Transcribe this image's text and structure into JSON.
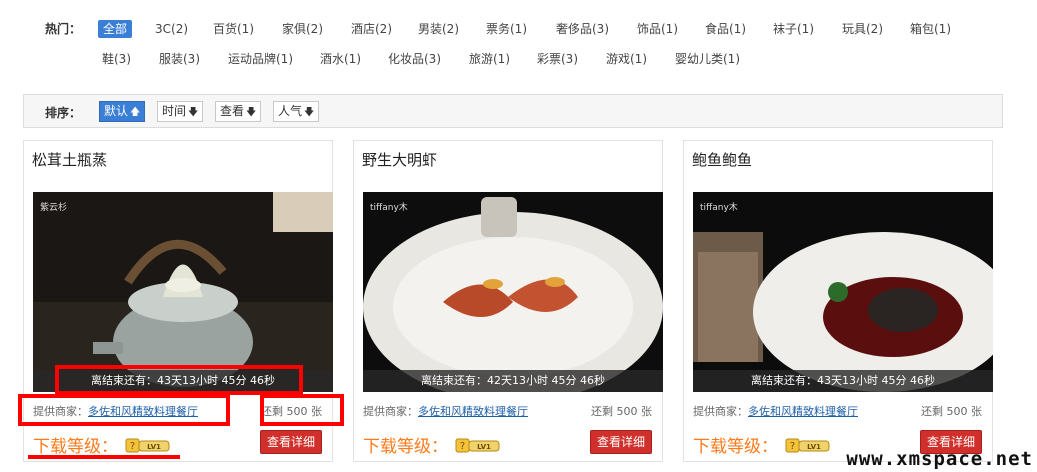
{
  "hot": {
    "label": "热门：",
    "categories": [
      "全部",
      "3C(2)",
      "百货(1)",
      "家俱(2)",
      "酒店(2)",
      "男装(2)",
      "票务(1)",
      "奢侈品(3)",
      "饰品(1)",
      "食品(1)",
      "袜子(1)",
      "玩具(2)",
      "箱包(1)",
      "鞋(3)",
      "服装(3)",
      "运动品牌(1)",
      "酒水(1)",
      "化妆品(3)",
      "旅游(1)",
      "彩票(3)",
      "游戏(1)",
      "婴幼儿类(1)"
    ],
    "active_index": 0
  },
  "sort": {
    "label": "排序：",
    "buttons": [
      {
        "label": "默认",
        "arrow": "up-arrow-icon",
        "active": true
      },
      {
        "label": "时间",
        "arrow": "down-arrow-icon",
        "active": false
      },
      {
        "label": "查看",
        "arrow": "down-arrow-icon",
        "active": false
      },
      {
        "label": "人气",
        "arrow": "down-arrow-icon",
        "active": false
      }
    ]
  },
  "cards": [
    {
      "title": "松茸土瓶蒸",
      "photo_tag": "紫云杉",
      "countdown": "离结束还有：43天13小时 45分 46秒",
      "vendor_prefix": "提供商家：",
      "vendor": "多佐和风精致料理餐厅",
      "remain": "还剩 500 张",
      "level_label": "下载等级：",
      "level_badge": "LV1",
      "detail": "查看详细"
    },
    {
      "title": "野生大明虾",
      "photo_tag": "tiffany木",
      "countdown": "离结束还有：42天13小时 45分 46秒",
      "vendor_prefix": "提供商家：",
      "vendor": "多佐和风精致料理餐厅",
      "remain": "还剩 500 张",
      "level_label": "下载等级：",
      "level_badge": "LV1",
      "detail": "查看详细"
    },
    {
      "title": "鲍鱼鲍鱼",
      "photo_tag": "tiffany木",
      "countdown": "离结束还有：43天13小时 45分 46秒",
      "vendor_prefix": "提供商家：",
      "vendor": "多佐和风精致料理餐厅",
      "remain": "还剩 500 张",
      "level_label": "下载等级：",
      "level_badge": "LV1",
      "detail": "查看详细"
    }
  ],
  "watermark": "www.xmspace.net",
  "colors": {
    "accent": "#3a7fd5",
    "level_text": "#ff7a1a",
    "detail_button": "#d0302b",
    "annotation": "#ff0000"
  }
}
